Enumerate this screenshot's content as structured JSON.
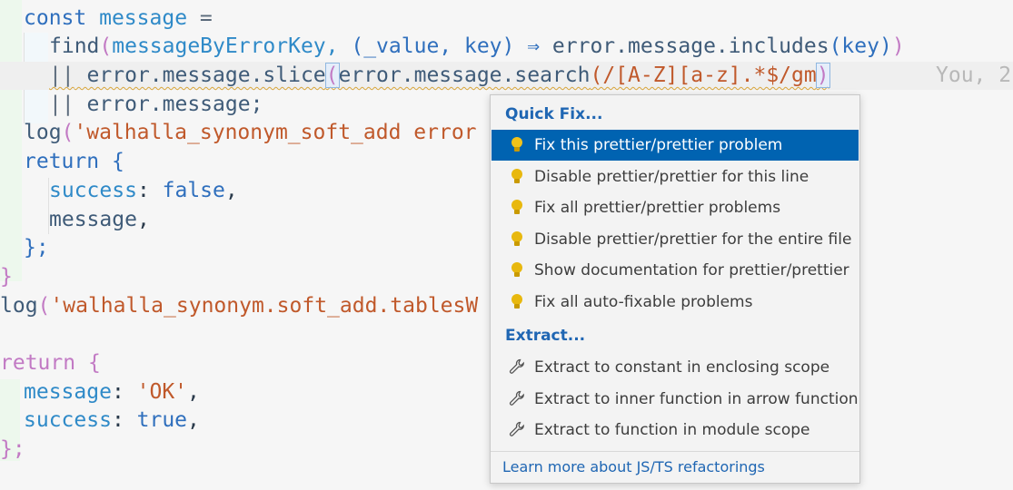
{
  "code": {
    "line1": {
      "kw": "const",
      "name": "message",
      "eq": "="
    },
    "line2": {
      "fn": "find",
      "args": "messageByErrorKey, ",
      "params": "(_value, key)",
      "arrow": " ⇒ ",
      "rest": "error.message.includes",
      "inner": "(key)",
      "close": ")"
    },
    "line3": {
      "op": "||",
      "a": " error.message.slice",
      "b": "error.message.search",
      "regex": "(/[A-Z][a-z].*$/gm",
      "c": ")",
      "ghost": "You, 2"
    },
    "line4": {
      "op": "||",
      "a": " error.message;"
    },
    "line5": {
      "fn": "log",
      "str": "'walhalla_synonym_soft_add error"
    },
    "line6": {
      "kw": "return",
      "brace": " {"
    },
    "line7": {
      "key": "success",
      "colon": ": ",
      "val": "false",
      "comma": ","
    },
    "line8": {
      "key": "message",
      "comma": ","
    },
    "line9": {
      "close": "};"
    },
    "line10": {
      "close": "}"
    },
    "line11": {
      "fn": "log",
      "str": "'walhalla_synonym.soft_add.tablesW"
    },
    "line12": {
      "kw": "return",
      "brace": " {"
    },
    "line13": {
      "key": "message",
      "colon": ": ",
      "val": "'OK'",
      "comma": ","
    },
    "line14": {
      "key": "success",
      "colon": ": ",
      "val": "true",
      "comma": ","
    },
    "line15": {
      "close": "};"
    }
  },
  "popup": {
    "quick_fix_title": "Quick Fix...",
    "quick_fix_items": [
      "Fix this prettier/prettier problem",
      "Disable prettier/prettier for this line",
      "Fix all prettier/prettier problems",
      "Disable prettier/prettier for the entire file",
      "Show documentation for prettier/prettier",
      "Fix all auto-fixable problems"
    ],
    "extract_title": "Extract...",
    "extract_items": [
      "Extract to constant in enclosing scope",
      "Extract to inner function in arrow function",
      "Extract to function in module scope"
    ],
    "footer": "Learn more about JS/TS refactorings",
    "selected_index": 0
  },
  "colors": {
    "accent": "#0063b1",
    "bulb": "#e8b80e",
    "link": "#1f66b3"
  }
}
